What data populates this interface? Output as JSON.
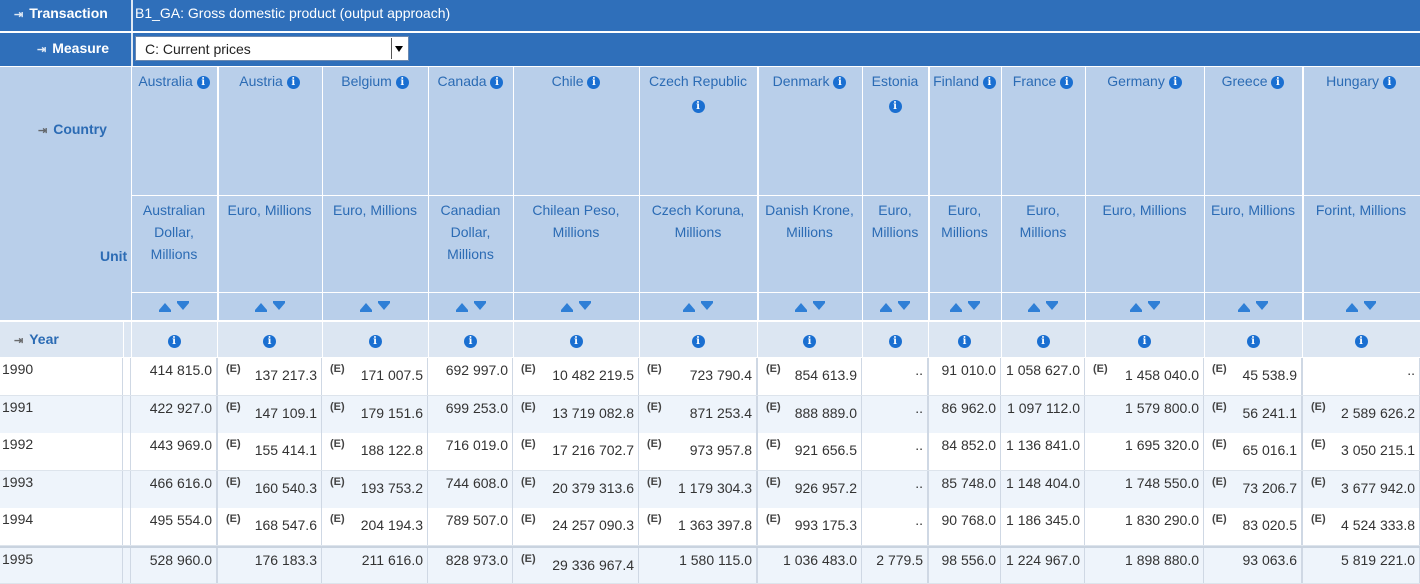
{
  "transaction": {
    "label": "Transaction",
    "value": "B1_GA: Gross domestic product (output approach)"
  },
  "measure": {
    "label": "Measure",
    "selected": "C: Current prices"
  },
  "country_label": "Country",
  "unit_label": "Unit",
  "year_label": "Year",
  "estimate_flag": "(E)",
  "columns": [
    {
      "country": "Australia",
      "unit": "Australian Dollar, Millions"
    },
    {
      "country": "Austria",
      "unit": "Euro, Millions"
    },
    {
      "country": "Belgium",
      "unit": "Euro, Millions"
    },
    {
      "country": "Canada",
      "unit": "Canadian Dollar, Millions"
    },
    {
      "country": "Chile",
      "unit": "Chilean Peso, Millions"
    },
    {
      "country": "Czech Republic",
      "unit": "Czech Koruna, Millions"
    },
    {
      "country": "Denmark",
      "unit": "Danish Krone, Millions"
    },
    {
      "country": "Estonia",
      "unit": "Euro, Millions"
    },
    {
      "country": "Finland",
      "unit": "Euro, Millions"
    },
    {
      "country": "France",
      "unit": "Euro, Millions"
    },
    {
      "country": "Germany",
      "unit": "Euro, Millions"
    },
    {
      "country": "Greece",
      "unit": "Euro, Millions"
    },
    {
      "country": "Hungary",
      "unit": "Forint, Millions"
    }
  ],
  "rows": [
    {
      "year": "1990",
      "values": [
        "414 815.0",
        "137 217.3",
        "171 007.5",
        "692 997.0",
        "10 482 219.5",
        "723 790.4",
        "854 613.9",
        "..",
        "91 010.0",
        "1 058 627.0",
        "1 458 040.0",
        "45 538.9",
        ".."
      ],
      "flags": [
        false,
        true,
        true,
        false,
        true,
        true,
        true,
        false,
        false,
        false,
        true,
        true,
        false
      ]
    },
    {
      "year": "1991",
      "values": [
        "422 927.0",
        "147 109.1",
        "179 151.6",
        "699 253.0",
        "13 719 082.8",
        "871 253.4",
        "888 889.0",
        "..",
        "86 962.0",
        "1 097 112.0",
        "1 579 800.0",
        "56 241.1",
        "2 589 626.2"
      ],
      "flags": [
        false,
        true,
        true,
        false,
        true,
        true,
        true,
        false,
        false,
        false,
        false,
        true,
        true
      ]
    },
    {
      "year": "1992",
      "values": [
        "443 969.0",
        "155 414.1",
        "188 122.8",
        "716 019.0",
        "17 216 702.7",
        "973 957.8",
        "921 656.5",
        "..",
        "84 852.0",
        "1 136 841.0",
        "1 695 320.0",
        "65 016.1",
        "3 050 215.1"
      ],
      "flags": [
        false,
        true,
        true,
        false,
        true,
        true,
        true,
        false,
        false,
        false,
        false,
        true,
        true
      ]
    },
    {
      "year": "1993",
      "values": [
        "466 616.0",
        "160 540.3",
        "193 753.2",
        "744 608.0",
        "20 379 313.6",
        "1 179 304.3",
        "926 957.2",
        "..",
        "85 748.0",
        "1 148 404.0",
        "1 748 550.0",
        "73 206.7",
        "3 677 942.0"
      ],
      "flags": [
        false,
        true,
        true,
        false,
        true,
        true,
        true,
        false,
        false,
        false,
        false,
        true,
        true
      ]
    },
    {
      "year": "1994",
      "values": [
        "495 554.0",
        "168 547.6",
        "204 194.3",
        "789 507.0",
        "24 257 090.3",
        "1 363 397.8",
        "993 175.3",
        "..",
        "90 768.0",
        "1 186 345.0",
        "1 830 290.0",
        "83 020.5",
        "4 524 333.8"
      ],
      "flags": [
        false,
        true,
        true,
        false,
        true,
        true,
        true,
        false,
        false,
        false,
        false,
        true,
        true
      ]
    },
    {
      "year": "1995",
      "values": [
        "528 960.0",
        "176 183.3",
        "211 616.0",
        "828 973.0",
        "29 336 967.4",
        "1 580 115.0",
        "1 036 483.0",
        "2 779.5",
        "98 556.0",
        "1 224 967.0",
        "1 898 880.0",
        "93 063.6",
        "5 819 221.0"
      ],
      "flags": [
        false,
        false,
        false,
        false,
        true,
        false,
        false,
        false,
        false,
        false,
        false,
        false,
        false
      ]
    }
  ]
}
